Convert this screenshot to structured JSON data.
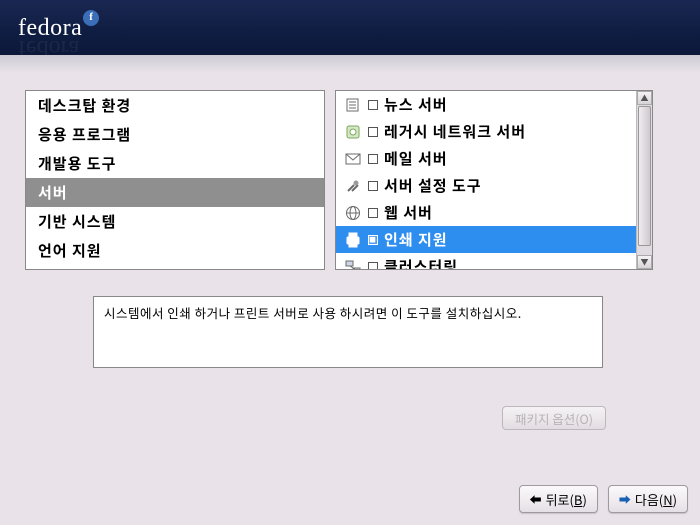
{
  "brand": "fedora",
  "categories": {
    "items": [
      {
        "label": "데스크탑 환경",
        "selected": false
      },
      {
        "label": "응용 프로그램",
        "selected": false
      },
      {
        "label": "개발용 도구",
        "selected": false
      },
      {
        "label": "서버",
        "selected": true
      },
      {
        "label": "기반 시스템",
        "selected": false
      },
      {
        "label": "언어 지원",
        "selected": false
      }
    ]
  },
  "packages": {
    "items": [
      {
        "icon": "news-icon",
        "label": "뉴스 서버",
        "checked": false,
        "selected": false
      },
      {
        "icon": "legacy-net-icon",
        "label": "레거시 네트워크 서버",
        "checked": false,
        "selected": false
      },
      {
        "icon": "mail-icon",
        "label": "메일 서버",
        "checked": false,
        "selected": false
      },
      {
        "icon": "config-icon",
        "label": "서버 설정 도구",
        "checked": false,
        "selected": false
      },
      {
        "icon": "web-icon",
        "label": "웹 서버",
        "checked": false,
        "selected": false
      },
      {
        "icon": "printer-icon",
        "label": "인쇄 지원",
        "checked": true,
        "selected": true
      },
      {
        "icon": "cluster-icon",
        "label": "클러스터링",
        "checked": false,
        "selected": false
      }
    ]
  },
  "description": "시스템에서 인쇄 하거나 프린트 서버로 사용 하시려면 이 도구를 설치하십시오.",
  "buttons": {
    "package_options": "패키지 옵션(O)",
    "back_prefix": "뒤로(",
    "back_key": "B",
    "back_suffix": ")",
    "next_prefix": "다음(",
    "next_key": "N",
    "next_suffix": ")"
  }
}
